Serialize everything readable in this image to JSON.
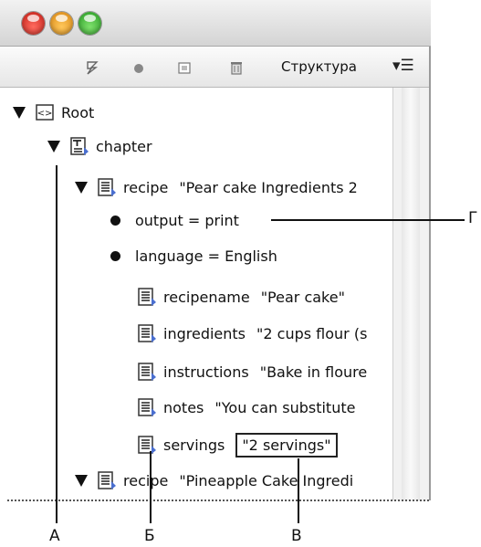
{
  "panel": {
    "title": "Структура",
    "toolbar_icons": [
      "script-icon",
      "record-icon",
      "new-element-icon",
      "trash-icon"
    ],
    "colors": {
      "close": "#e0302a",
      "minimize": "#f2a42a",
      "zoom": "#3cb73a"
    }
  },
  "tree": {
    "root": "Root",
    "chapter": "chapter",
    "recipe1": {
      "name": "recipe",
      "value": "\"Pear cake Ingredients 2"
    },
    "attr_output": "output = print",
    "attr_language": "language = English",
    "recipename": {
      "name": "recipename",
      "value": "\"Pear cake\""
    },
    "ingredients": {
      "name": "ingredients",
      "value": "\"2 cups flour (s"
    },
    "instructions": {
      "name": "instructions",
      "value": "\"Bake in floure"
    },
    "notes": {
      "name": "notes",
      "value": "\"You can substitute"
    },
    "servings": {
      "name": "servings",
      "value": "\"2 servings\""
    },
    "recipe2": {
      "name": "recipe",
      "value": "\"Pineapple Cake Ingredi"
    }
  },
  "callouts": {
    "a": "А",
    "b": "Б",
    "v": "В",
    "g": "Г"
  }
}
